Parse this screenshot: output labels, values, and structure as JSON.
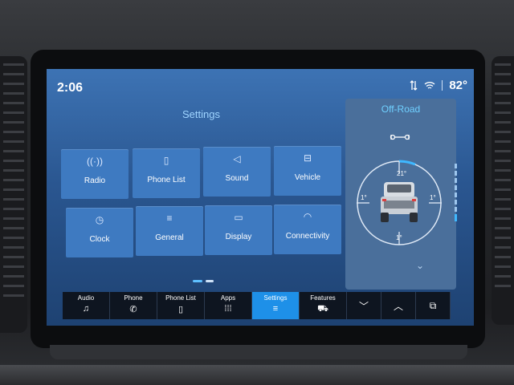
{
  "status": {
    "time": "2:06",
    "temperature": "82°",
    "icons": [
      "usb-icon",
      "wifi-icon",
      "divider"
    ]
  },
  "settings": {
    "title": "Settings",
    "tiles": [
      {
        "label": "Radio",
        "icon": "radio-icon",
        "glyph": "((·))"
      },
      {
        "label": "Phone List",
        "icon": "phone-list-icon",
        "glyph": "▯"
      },
      {
        "label": "Sound",
        "icon": "sound-icon",
        "glyph": "◁"
      },
      {
        "label": "Vehicle",
        "icon": "vehicle-icon",
        "glyph": "⊟"
      },
      {
        "label": "Clock",
        "icon": "clock-icon",
        "glyph": "◷"
      },
      {
        "label": "General",
        "icon": "general-icon",
        "glyph": "≡"
      },
      {
        "label": "Display",
        "icon": "display-icon",
        "glyph": "▭"
      },
      {
        "label": "Connectivity",
        "icon": "connectivity-icon",
        "glyph": "◠"
      }
    ],
    "page_indicator": {
      "pages": 2,
      "current": 1
    }
  },
  "offroad": {
    "title": "Off-Road",
    "pitch_front": "21°",
    "roll_left": "1°",
    "roll_right": "1°",
    "pitch_rear": "1°"
  },
  "nav": {
    "items": [
      {
        "label": "Audio",
        "icon": "music-note-icon",
        "glyph": "♫"
      },
      {
        "label": "Phone",
        "icon": "phone-icon",
        "glyph": "✆"
      },
      {
        "label": "Phone List",
        "icon": "phone-list-icon",
        "glyph": "▯"
      },
      {
        "label": "Apps",
        "icon": "apps-grid-icon",
        "glyph": "⁞⁞⁞"
      },
      {
        "label": "Settings",
        "icon": "settings-sliders-icon",
        "glyph": "≡",
        "active": true
      },
      {
        "label": "Features",
        "icon": "truck-icon",
        "glyph": "⛟"
      }
    ],
    "controls": [
      {
        "icon": "chevron-down-icon",
        "glyph": "﹀"
      },
      {
        "icon": "chevron-up-icon",
        "glyph": "︿"
      },
      {
        "icon": "screen-toggle-icon",
        "glyph": "⧉"
      }
    ]
  },
  "colors": {
    "accent": "#1e90e8",
    "tile": "#3e7ac1",
    "title": "#9fd4ff",
    "offroad_title": "#6fd0ff"
  }
}
